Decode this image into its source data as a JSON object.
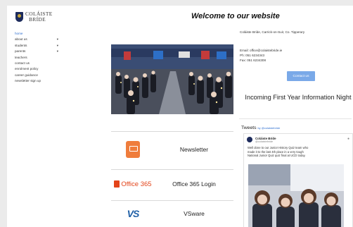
{
  "brand": {
    "name_line1": "COLÁISTE",
    "name_line2": "BRÍDE"
  },
  "nav": [
    {
      "label": "home",
      "active": true,
      "dropdown": false
    },
    {
      "label": "about us",
      "active": false,
      "dropdown": true
    },
    {
      "label": "students",
      "active": false,
      "dropdown": true
    },
    {
      "label": "parents",
      "active": false,
      "dropdown": true
    },
    {
      "label": "teachers",
      "active": false,
      "dropdown": false
    },
    {
      "label": "contact us",
      "active": false,
      "dropdown": false
    },
    {
      "label": "enrolment policy",
      "active": false,
      "dropdown": false
    },
    {
      "label": "career guidance",
      "active": false,
      "dropdown": false
    },
    {
      "label": "newsletter sign up",
      "active": false,
      "dropdown": false
    }
  ],
  "header": {
    "title": "Welcome to our website"
  },
  "contact": {
    "address": "Coláiste Bríde, Carrick-on-Suir, Co. Tipperary",
    "email": "Email: office@colaistebride.ie",
    "phone": "Ph: 051 6234343",
    "fax": "Fax: 051 6234308",
    "button_label": "Contact us"
  },
  "tiles": {
    "newsletter_label": "Newsletter",
    "office_logo_text": "Office 365",
    "office_label": "Office 365 Login",
    "vsware_logo_text": "VS",
    "vsware_label": "VSware"
  },
  "info": {
    "title": "Incoming First Year Information Night"
  },
  "tweets": {
    "heading": "Tweets",
    "by": "by @colaistebride",
    "author": "Coláiste Bríde",
    "handle": "@colaistebride",
    "text": "Well done to our Junior History Quiz team who made it to the last 4th place in a very tough National Junior Quiz quiz final at UCD today."
  },
  "icons": [
    "crest-logo",
    "chevron-down-icon",
    "newsletter-icon",
    "office-icon",
    "vsware-logo",
    "twitter-icon"
  ],
  "colors": {
    "nav_active": "#2f6fd0",
    "button": "#7aa9e8",
    "newsletter_icon": "#ef7d3c",
    "office": "#e3441a"
  }
}
